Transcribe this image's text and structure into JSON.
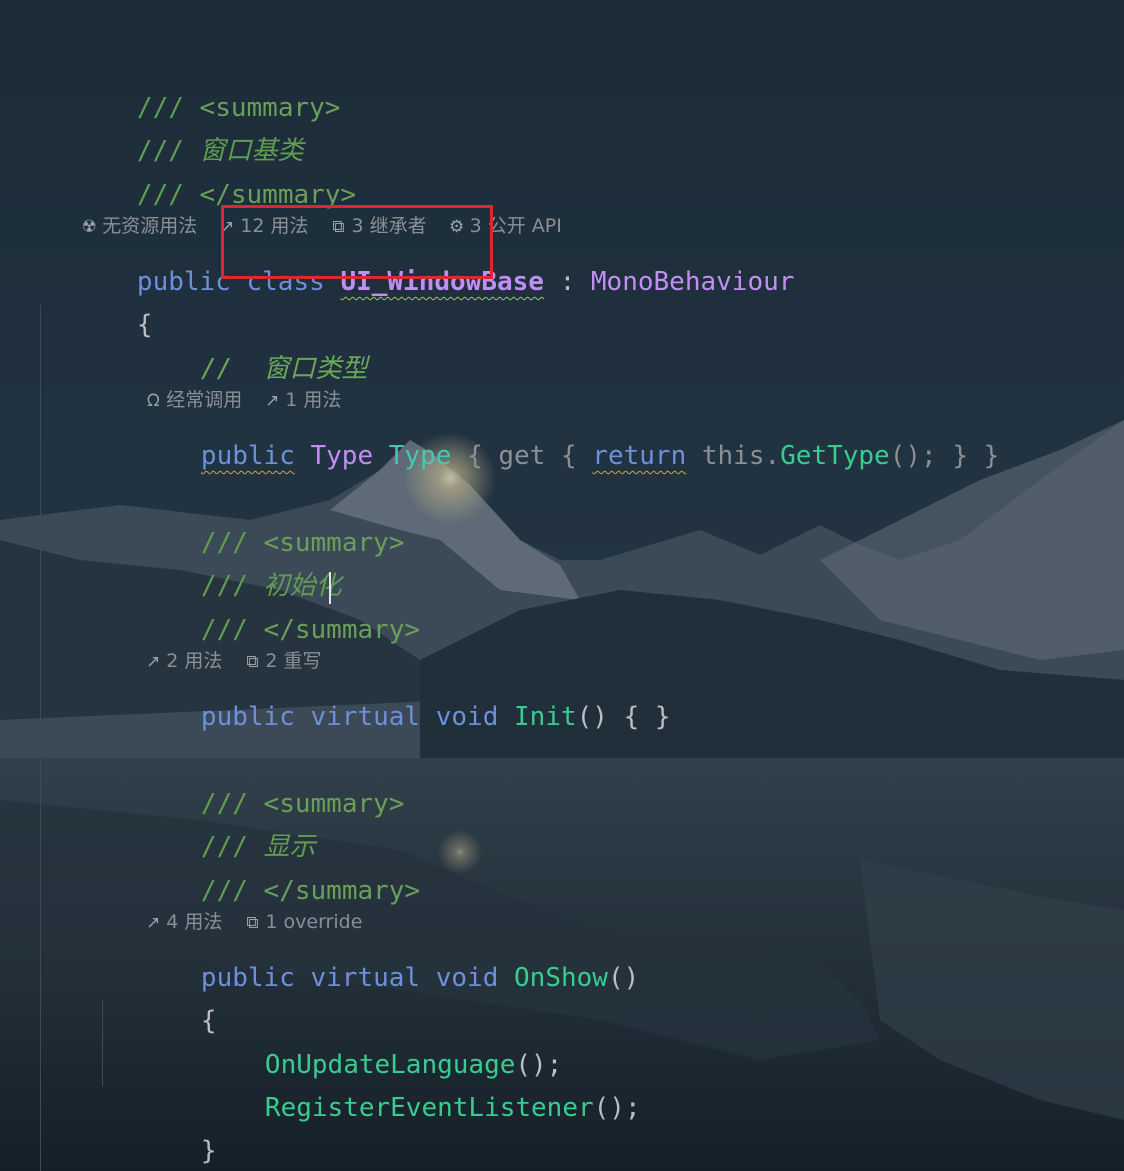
{
  "hints": {
    "class": [
      {
        "icon": "no-usage-icon",
        "glyph": "☢",
        "text": "无资源用法"
      },
      {
        "icon": "usages-icon",
        "glyph": "↗",
        "text": "12 用法"
      },
      {
        "icon": "inheritors-icon",
        "glyph": "⧉",
        "text": "3 继承者"
      },
      {
        "icon": "public-api-icon",
        "glyph": "⚙",
        "text": "3 公开 API"
      }
    ],
    "type_prop": [
      {
        "icon": "frequent-call-icon",
        "glyph": "🔥",
        "text": "经常调用"
      },
      {
        "icon": "usages-icon",
        "glyph": "↗",
        "text": "1 用法"
      }
    ],
    "init": [
      {
        "icon": "usages-icon",
        "glyph": "↗",
        "text": "2 用法"
      },
      {
        "icon": "overrides-icon",
        "glyph": "⧉",
        "text": "2 重写"
      }
    ],
    "onshow": [
      {
        "icon": "usages-icon",
        "glyph": "↗",
        "text": "4 用法"
      },
      {
        "icon": "overrides-icon",
        "glyph": "⧉",
        "text": "1 override"
      }
    ]
  },
  "code": {
    "slashes": "///",
    "summary_open": "<summary>",
    "summary_close": "</summary>",
    "class_doc": "窗口基类",
    "kw_public": "public",
    "kw_class": "class",
    "class_name": "UI_WindowBase",
    "colon": ":",
    "base_class": "MonoBehaviour",
    "open_brace": "{",
    "close_brace": "}",
    "type_comment": "//  窗口类型",
    "type_type": "Type",
    "type_prop": "Type",
    "getter": "{ get { ",
    "kw_return": "return",
    "this_dot": " this.",
    "gettype": "GetType",
    "gettype_tail": "(); } }",
    "init_doc": "初始化",
    "kw_virtual": "virtual",
    "kw_void": "void",
    "init_name": "Init",
    "init_tail": "() { }",
    "show_doc": "显示",
    "onshow_name": "OnShow",
    "onshow_paren": "()",
    "call_language": "OnUpdateLanguage",
    "call_register": "RegisterEventListener",
    "call_tail": "();"
  },
  "colors": {
    "keyword": "#6e8fd9",
    "class_name": "#c18ff4",
    "method": "#39cc8f",
    "doc_comment": "#5f9e52",
    "highlight_box": "#e0262e"
  }
}
